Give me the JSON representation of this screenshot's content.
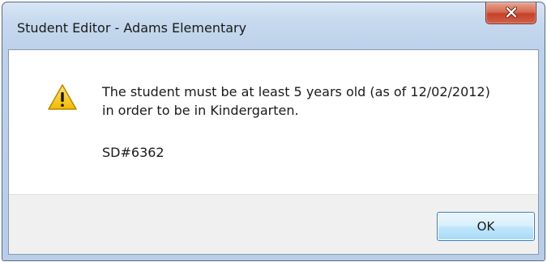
{
  "window": {
    "title": "Student Editor - Adams Elementary"
  },
  "message": {
    "line1": "The student must be at least 5 years old (as of 12/02/2012)",
    "line2": "in order to be in Kindergarten.",
    "code": "SD#6362",
    "icon": "warning-icon"
  },
  "buttons": {
    "ok_label": "OK",
    "close_icon": "close-icon"
  },
  "colors": {
    "close_button": "#c4422a",
    "ok_button_border": "#3c7fb1",
    "warning_fill": "#f5c518"
  }
}
